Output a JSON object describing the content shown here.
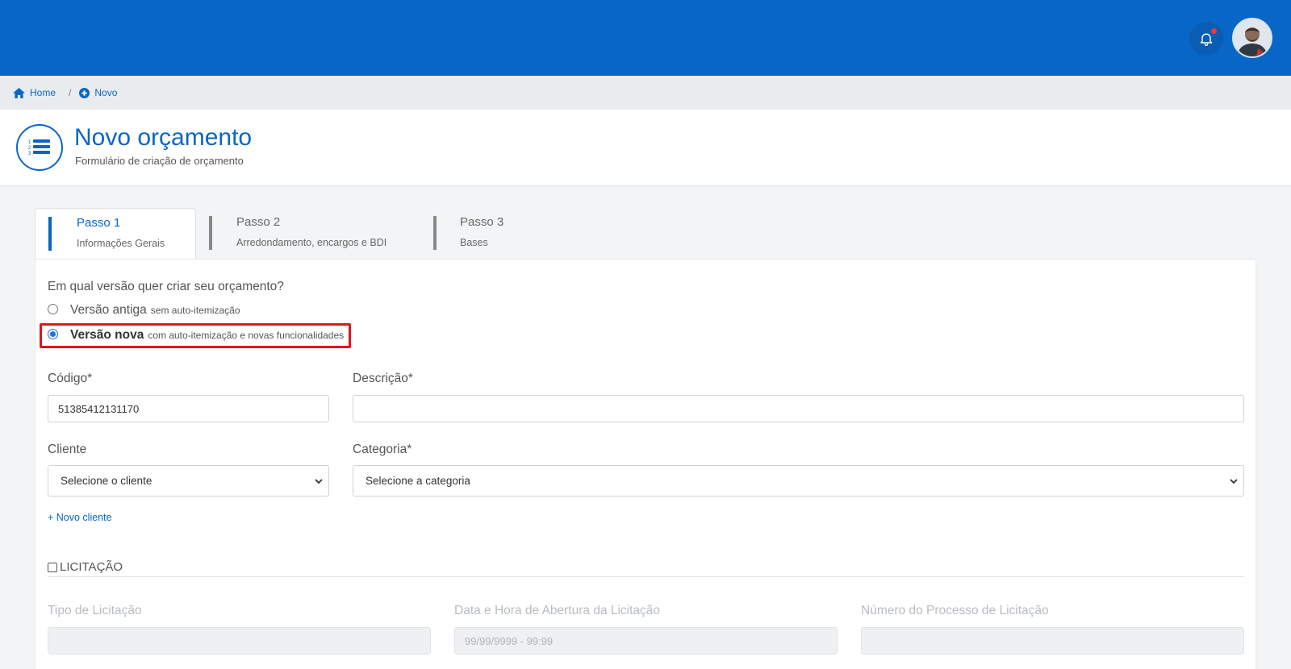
{
  "breadcrumb": {
    "home_label": "Home",
    "separator": "/",
    "new_label": "Novo"
  },
  "header": {
    "title": "Novo orçamento",
    "subtitle": "Formulário de criação de orçamento"
  },
  "steps": [
    {
      "title": "Passo 1",
      "subtitle": "Informações Gerais",
      "active": true
    },
    {
      "title": "Passo 2",
      "subtitle": "Arredondamento, encargos e BDI",
      "active": false
    },
    {
      "title": "Passo 3",
      "subtitle": "Bases",
      "active": false
    }
  ],
  "form": {
    "version_question": "Em qual versão quer criar seu orçamento?",
    "version_options": [
      {
        "label": "Versão antiga",
        "detail": "sem auto-itemização",
        "selected": false
      },
      {
        "label": "Versão nova",
        "detail": "com auto-itemização e novas funcionalidades",
        "selected": true
      }
    ],
    "code_label": "Código*",
    "code_value": "51385412131170",
    "description_label": "Descrição*",
    "description_value": "",
    "client_label": "Cliente",
    "client_selected": "Selecione o cliente",
    "category_label": "Categoria*",
    "category_selected": "Selecione a categoria",
    "new_client_link": "+ Novo cliente",
    "bidding_checkbox_label": "LICITAÇÃO",
    "bidding_checked": false,
    "bidding_type_label": "Tipo de Licitação",
    "bidding_type_value": "",
    "bidding_date_label": "Data e Hora de Abertura da Licitação",
    "bidding_date_placeholder": "99/99/9999 - 99:99",
    "bidding_process_label": "Número do Processo de Licitação",
    "bidding_process_value": ""
  },
  "colors": {
    "primary": "#0866c6",
    "highlight_border": "#e0161c",
    "notification_dot": "#e53935"
  },
  "icons": {
    "bell": "bell-icon",
    "home": "home-icon",
    "plus_circle": "plus-circle-icon",
    "list": "numbered-list-icon"
  }
}
